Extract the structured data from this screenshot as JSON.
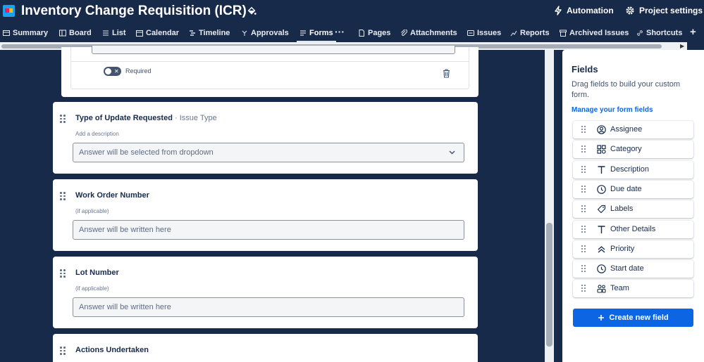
{
  "header": {
    "title": "Inventory Change Requisition (ICR)",
    "automation_label": "Automation",
    "project_settings_label": "Project settings"
  },
  "tabs": [
    {
      "label": "Summary",
      "icon": "globe-icon"
    },
    {
      "label": "Board",
      "icon": "board-icon"
    },
    {
      "label": "List",
      "icon": "list-icon"
    },
    {
      "label": "Calendar",
      "icon": "calendar-icon"
    },
    {
      "label": "Timeline",
      "icon": "timeline-icon"
    },
    {
      "label": "Approvals",
      "icon": "approvals-icon"
    },
    {
      "label": "Forms",
      "icon": "forms-icon",
      "active": true
    },
    {
      "label": "Pages",
      "icon": "page-icon"
    },
    {
      "label": "Attachments",
      "icon": "attachment-icon"
    },
    {
      "label": "Issues",
      "icon": "issues-icon"
    },
    {
      "label": "Reports",
      "icon": "reports-icon"
    },
    {
      "label": "Archived Issues",
      "icon": "archive-icon"
    },
    {
      "label": "Shortcuts",
      "icon": "link-icon"
    }
  ],
  "tabs_more": "···",
  "tabs_add": "+",
  "form": {
    "top_card": {
      "required_label": "Required"
    },
    "questions": [
      {
        "title": "Type of Update Requested",
        "type_suffix": " · Issue Type",
        "description": "Add a description",
        "answer_placeholder": "Answer will be selected from dropdown"
      },
      {
        "title": "Work Order Number",
        "description": "(if applicable)",
        "answer_placeholder": "Answer will be written here"
      },
      {
        "title": "Lot Number",
        "description": "(if applicable)",
        "answer_placeholder": "Answer will be written here"
      },
      {
        "title": "Actions Undertaken"
      }
    ]
  },
  "fields_panel": {
    "title": "Fields",
    "description": "Drag fields to build your custom form.",
    "manage_link": "Manage your form fields",
    "items": [
      {
        "label": "Assignee",
        "icon": "person-icon"
      },
      {
        "label": "Category",
        "icon": "category-icon"
      },
      {
        "label": "Description",
        "icon": "text-icon"
      },
      {
        "label": "Due date",
        "icon": "clock-icon"
      },
      {
        "label": "Labels",
        "icon": "tag-icon"
      },
      {
        "label": "Other Details",
        "icon": "text-icon"
      },
      {
        "label": "Priority",
        "icon": "priority-icon"
      },
      {
        "label": "Start date",
        "icon": "clock-icon"
      },
      {
        "label": "Team",
        "icon": "team-icon"
      }
    ],
    "create_button": "Create new field"
  },
  "colors": {
    "background": "#182a4a",
    "primary_button": "#0c66e4",
    "link": "#0c66e4"
  }
}
